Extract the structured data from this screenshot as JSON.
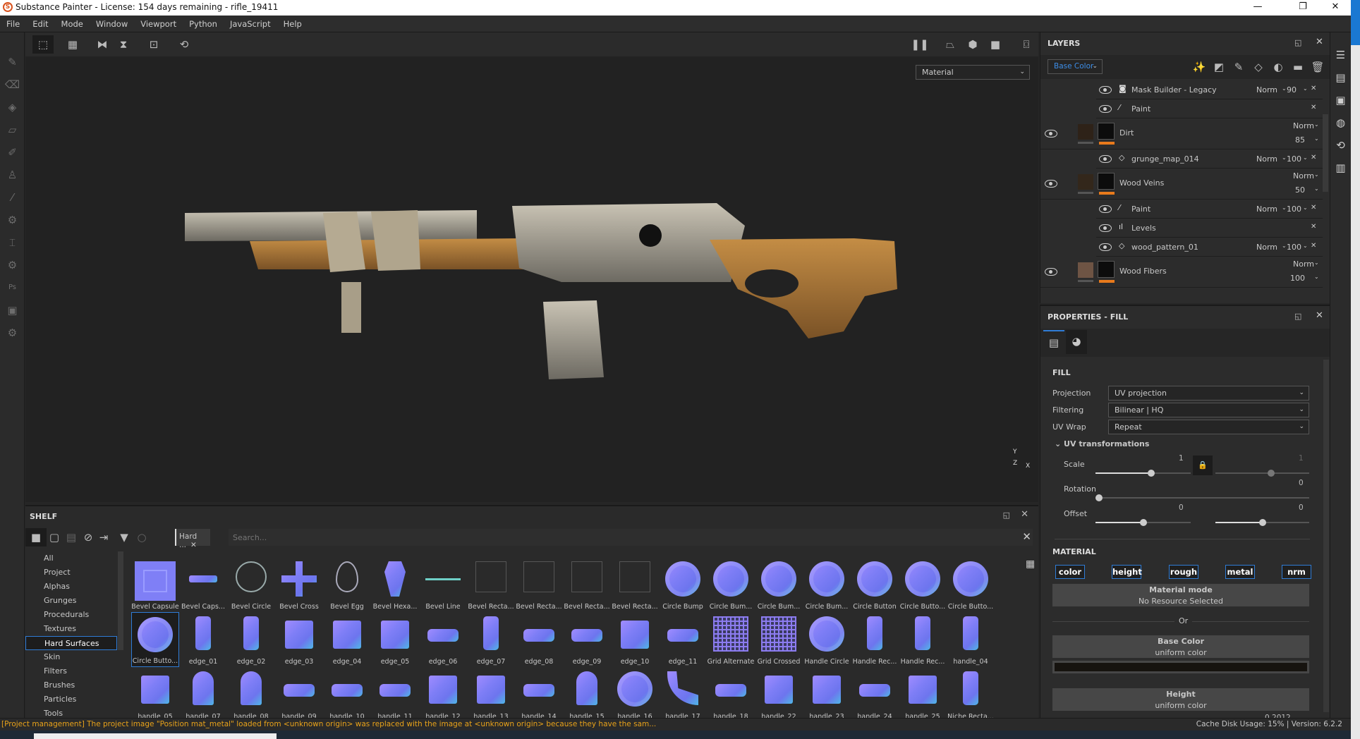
{
  "window": {
    "title": "Substance Painter - License: 154 days remaining - rifle_19411",
    "minimize": "—",
    "maximize": "❐",
    "close": "✕"
  },
  "menu": [
    "File",
    "Edit",
    "Mode",
    "Window",
    "Viewport",
    "Python",
    "JavaScript",
    "Help"
  ],
  "viewport": {
    "channel_select": "Material",
    "axis_labels": {
      "y": "Y",
      "x": "X",
      "z": "Z"
    }
  },
  "shelf": {
    "title": "SHELF",
    "filter_chip": "Hard ...",
    "search_placeholder": "Search...",
    "categories": [
      "All",
      "Project",
      "Alphas",
      "Grunges",
      "Procedurals",
      "Textures",
      "Hard Surfaces",
      "Skin",
      "Filters",
      "Brushes",
      "Particles",
      "Tools"
    ],
    "selected_category": "Hard Surfaces",
    "items": [
      {
        "label": "Bevel Capsule",
        "shape": "capsule-tile"
      },
      {
        "label": "Bevel Caps...",
        "shape": "bar"
      },
      {
        "label": "Bevel Circle",
        "shape": "ring"
      },
      {
        "label": "Bevel Cross",
        "shape": "cross"
      },
      {
        "label": "Bevel Egg",
        "shape": "egg"
      },
      {
        "label": "Bevel Hexa...",
        "shape": "hexagon"
      },
      {
        "label": "Bevel Line",
        "shape": "line"
      },
      {
        "label": "Bevel Recta...",
        "shape": "rect-outline"
      },
      {
        "label": "Bevel Recta...",
        "shape": "rect-outline"
      },
      {
        "label": "Bevel Recta...",
        "shape": "rect-outline"
      },
      {
        "label": "Bevel Recta...",
        "shape": "rect-outline"
      },
      {
        "label": "Circle Bump",
        "shape": "disc"
      },
      {
        "label": "Circle Bum...",
        "shape": "disc"
      },
      {
        "label": "Circle Bum...",
        "shape": "disc"
      },
      {
        "label": "Circle Bum...",
        "shape": "disc"
      },
      {
        "label": "Circle Button",
        "shape": "disc"
      },
      {
        "label": "Circle Butto...",
        "shape": "disc"
      },
      {
        "label": "Circle Butto...",
        "shape": "disc"
      },
      {
        "label": "Circle Butto...",
        "shape": "disc"
      },
      {
        "label": "edge_01",
        "shape": "tall"
      },
      {
        "label": "edge_02",
        "shape": "tall"
      },
      {
        "label": "edge_03",
        "shape": "block"
      },
      {
        "label": "edge_04",
        "shape": "block"
      },
      {
        "label": "edge_05",
        "shape": "block"
      },
      {
        "label": "edge_06",
        "shape": "wide"
      },
      {
        "label": "edge_07",
        "shape": "tall"
      },
      {
        "label": "edge_08",
        "shape": "wide"
      },
      {
        "label": "edge_09",
        "shape": "wide"
      },
      {
        "label": "edge_10",
        "shape": "block"
      },
      {
        "label": "edge_11",
        "shape": "wide"
      },
      {
        "label": "Grid Alternate",
        "shape": "grid"
      },
      {
        "label": "Grid Crossed",
        "shape": "grid"
      },
      {
        "label": "Handle Circle",
        "shape": "disc"
      },
      {
        "label": "Handle Rec...",
        "shape": "tall"
      },
      {
        "label": "Handle Rec...",
        "shape": "tall"
      },
      {
        "label": "handle_04",
        "shape": "tall"
      },
      {
        "label": "handle_05",
        "shape": "block"
      },
      {
        "label": "handle_07",
        "shape": "arch"
      },
      {
        "label": "handle_08",
        "shape": "arch"
      },
      {
        "label": "handle_09",
        "shape": "wide"
      },
      {
        "label": "handle_10",
        "shape": "wide"
      },
      {
        "label": "handle_11",
        "shape": "wide"
      },
      {
        "label": "handle_12",
        "shape": "block"
      },
      {
        "label": "handle_13",
        "shape": "block"
      },
      {
        "label": "handle_14",
        "shape": "wide"
      },
      {
        "label": "handle_15",
        "shape": "arch"
      },
      {
        "label": "handle_16",
        "shape": "disc"
      },
      {
        "label": "handle_17",
        "shape": "curve"
      },
      {
        "label": "handle_18",
        "shape": "wide"
      },
      {
        "label": "handle_22",
        "shape": "block"
      },
      {
        "label": "handle_23",
        "shape": "block"
      },
      {
        "label": "handle_24",
        "shape": "wide"
      },
      {
        "label": "handle_25",
        "shape": "block"
      },
      {
        "label": "Niche Recta...",
        "shape": "tall"
      }
    ],
    "selected_item": "Circle Butto..."
  },
  "layers": {
    "title": "LAYERS",
    "channel": "Base Color",
    "rows": [
      {
        "type": "effect",
        "name": "Mask Builder - Legacy",
        "icon": "mask-icon",
        "blend": "Norm",
        "opacity": "90"
      },
      {
        "type": "effect",
        "name": "Paint",
        "icon": "brush-icon",
        "blend": "",
        "opacity": ""
      },
      {
        "type": "layer",
        "name": "Dirt",
        "blend": "Norm",
        "opacity": "85",
        "swatch": "#2e2218"
      },
      {
        "type": "effect",
        "name": "grunge_map_014",
        "icon": "fill-icon",
        "blend": "Norm",
        "opacity": "100"
      },
      {
        "type": "layer",
        "name": "Wood Veins",
        "blend": "Norm",
        "opacity": "50",
        "swatch": "#33271b"
      },
      {
        "type": "effect",
        "name": "Paint",
        "icon": "brush-icon",
        "blend": "Norm",
        "opacity": "100"
      },
      {
        "type": "effect",
        "name": "Levels",
        "icon": "levels-icon",
        "blend": "",
        "opacity": ""
      },
      {
        "type": "effect",
        "name": "wood_pattern_01",
        "icon": "fill-icon",
        "blend": "Norm",
        "opacity": "100"
      },
      {
        "type": "layer",
        "name": "Wood Fibers",
        "blend": "Norm",
        "opacity": "100",
        "swatch": "#6e5444"
      }
    ]
  },
  "properties": {
    "title": "PROPERTIES - FILL",
    "fill_heading": "FILL",
    "projection_label": "Projection",
    "projection": "UV projection",
    "filtering_label": "Filtering",
    "filtering": "Bilinear | HQ",
    "uvwrap_label": "UV Wrap",
    "uvwrap": "Repeat",
    "uvtrans_label": "UV transformations",
    "scale_label": "Scale",
    "scale_u": "1",
    "scale_v": "1",
    "rotation_label": "Rotation",
    "rotation": "0",
    "offset_label": "Offset",
    "offset_u": "0",
    "offset_v": "0",
    "material_heading": "MATERIAL",
    "channels": [
      "color",
      "height",
      "rough",
      "metal",
      "nrm"
    ],
    "material_mode_title": "Material mode",
    "material_mode_value": "No Resource Selected",
    "or": "Or",
    "base_color_title": "Base Color",
    "base_color_value": "uniform color",
    "base_color": "#16130f",
    "height_title": "Height",
    "height_value": "uniform color",
    "trailing_value": "0.2012"
  },
  "status": {
    "message": "[Project management] The project image \"Position mat_metal\" loaded from <unknown origin> was replaced with the image at <unknown origin> because they have the sam...",
    "cache": "Cache Disk Usage:   15% | Version: 6.2.2"
  },
  "colors": {
    "accent": "#2f7cd6",
    "warning": "#e8a21a",
    "layer_mask_bar": "#e87a1c"
  }
}
